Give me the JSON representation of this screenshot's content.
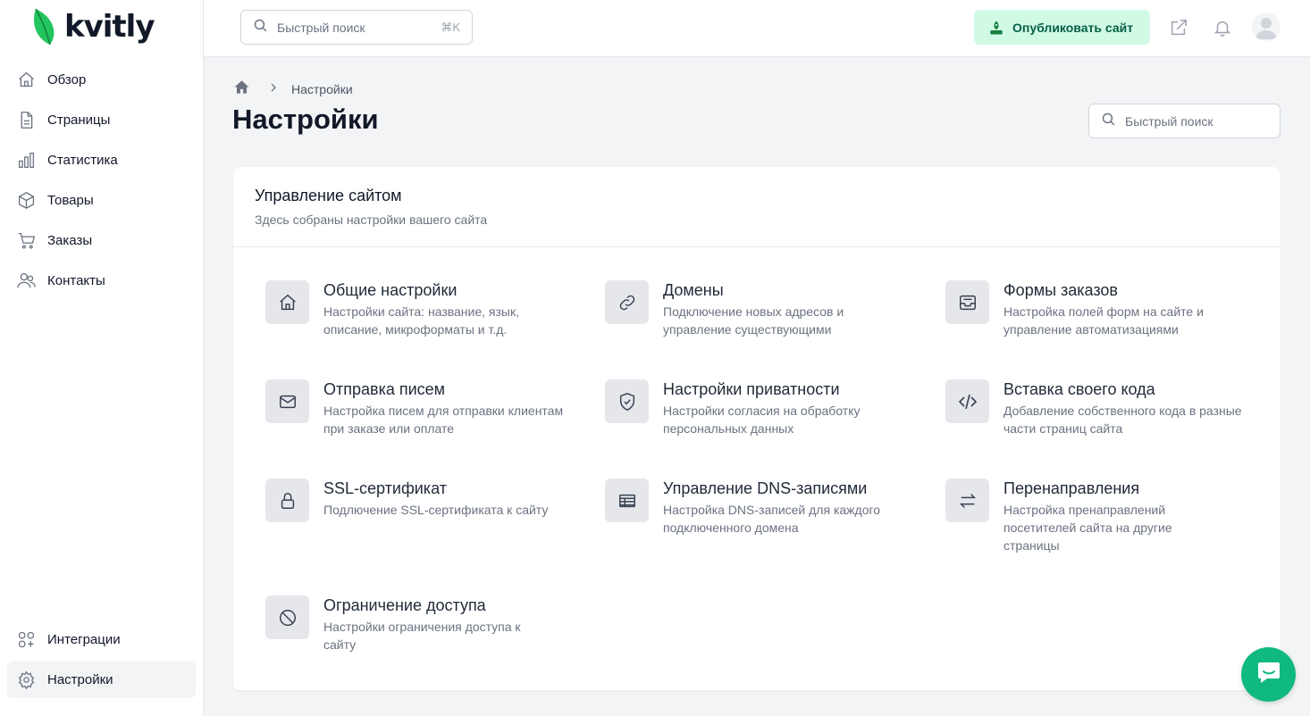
{
  "brand": {
    "name": "kvitly",
    "accent": "#10b981"
  },
  "sidebar": {
    "items": [
      {
        "label": "Обзор",
        "icon": "home-icon"
      },
      {
        "label": "Страницы",
        "icon": "document-icon"
      },
      {
        "label": "Статистика",
        "icon": "chart-icon"
      },
      {
        "label": "Товары",
        "icon": "cube-icon"
      },
      {
        "label": "Заказы",
        "icon": "cart-icon"
      },
      {
        "label": "Контакты",
        "icon": "users-icon"
      }
    ],
    "bottom": [
      {
        "label": "Интеграции",
        "icon": "integrations-icon"
      },
      {
        "label": "Настройки",
        "icon": "gear-icon",
        "active": true
      }
    ]
  },
  "topbar": {
    "search_placeholder": "Быстрый поиск",
    "search_shortcut": "⌘K",
    "publish_label": "Опубликовать сайт"
  },
  "breadcrumb": {
    "current": "Настройки"
  },
  "page": {
    "title": "Настройки",
    "search_placeholder": "Быстрый поиск"
  },
  "card": {
    "title": "Управление сайтом",
    "subtitle": "Здесь собраны настройки вашего сайта",
    "tiles": [
      {
        "title": "Общие настройки",
        "desc": "Настройки сайта: название, язык, описание, микроформаты и т.д.",
        "icon": "home-icon"
      },
      {
        "title": "Домены",
        "desc": "Подключение новых адресов и управление существующими",
        "icon": "link-icon"
      },
      {
        "title": "Формы заказов",
        "desc": "Настройка полей форм на сайте и управление автоматизациями",
        "icon": "inbox-icon"
      },
      {
        "title": "Отправка писем",
        "desc": "Настройка писем для отправки клиентам при заказе или оплате",
        "icon": "mail-icon"
      },
      {
        "title": "Настройки приватности",
        "desc": "Настройки согласия на обработку персональных данных",
        "icon": "shield-check-icon"
      },
      {
        "title": "Вставка своего кода",
        "desc": "Добавление собственного кода в разные части страниц сайта",
        "icon": "code-icon"
      },
      {
        "title": "SSL-сертификат",
        "desc": "Подлючение SSL-сертификата к сайту",
        "icon": "lock-icon"
      },
      {
        "title": "Управление DNS-записями",
        "desc": "Настройка DNS-записей для каждого подключенного домена",
        "icon": "table-icon"
      },
      {
        "title": "Перенаправления",
        "desc": "Настройка пренаправлений посетителей сайта на другие страницы",
        "icon": "arrows-swap-icon"
      },
      {
        "title": "Ограничение доступа",
        "desc": "Настройки ограничения доступа к сайту",
        "icon": "ban-icon"
      }
    ]
  }
}
